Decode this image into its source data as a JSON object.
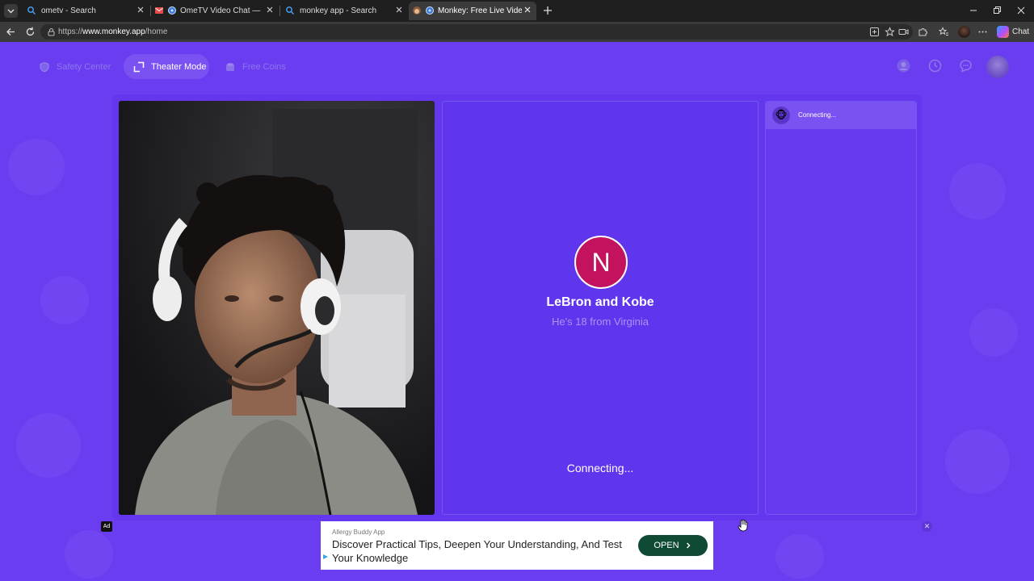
{
  "browser": {
    "tabs": [
      {
        "title": "ometv - Search",
        "favicon": "search-icon",
        "active": false
      },
      {
        "title": "OmeTV Video Chat — Omegl",
        "favicon": "globe-icon",
        "active": false
      },
      {
        "title": "monkey app - Search",
        "favicon": "search-icon",
        "active": false
      },
      {
        "title": "Monkey: Free Live Video Chat",
        "favicon": "monkey-icon",
        "active": true
      }
    ],
    "url_prefix": "https://",
    "url_host": "www.monkey.app",
    "url_path": "/home",
    "chat_label": "Chat"
  },
  "nav": {
    "safety_center": "Safety Center",
    "theater_mode": "Theater Mode",
    "free_coins": "Free Coins"
  },
  "partner": {
    "initial": "N",
    "name": "LeBron and Kobe",
    "subtitle": "He's 18 from Virginia",
    "status": "Connecting..."
  },
  "chat": {
    "status": "Connecting...",
    "monkey_emoji": "🐵"
  },
  "ad": {
    "tag": "Ad",
    "brand": "Allergy Buddy App",
    "headline": "Discover Practical Tips, Deepen Your Understanding, And Test Your Knowledge",
    "cta": "OPEN",
    "close": "✕"
  },
  "colors": {
    "page_bg": "#6b3df0",
    "avatar_bg": "#c4135e",
    "cta_bg": "#0f4a34"
  }
}
